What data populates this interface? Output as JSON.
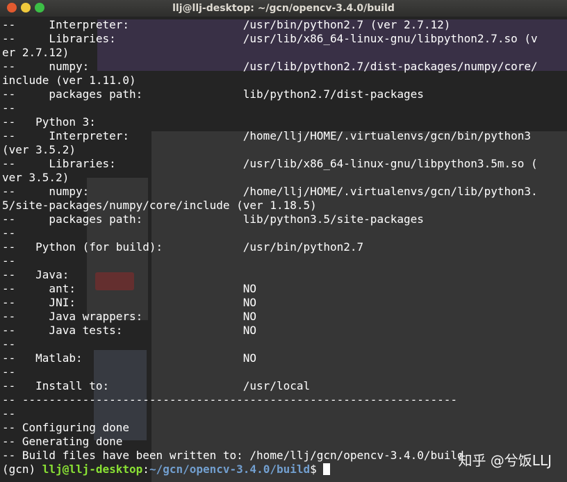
{
  "window": {
    "title": "llj@llj-desktop: ~/gcn/opencv-3.4.0/build"
  },
  "terminal": {
    "lines": [
      "--     Interpreter:                 /usr/bin/python2.7 (ver 2.7.12)",
      "--     Libraries:                   /usr/lib/x86_64-linux-gnu/libpython2.7.so (v",
      "er 2.7.12)",
      "--     numpy:                       /usr/lib/python2.7/dist-packages/numpy/core/",
      "include (ver 1.11.0)",
      "--     packages path:               lib/python2.7/dist-packages",
      "--",
      "--   Python 3:",
      "--     Interpreter:                 /home/llj/HOME/.virtualenvs/gcn/bin/python3",
      "(ver 3.5.2)",
      "--     Libraries:                   /usr/lib/x86_64-linux-gnu/libpython3.5m.so (",
      "ver 3.5.2)",
      "--     numpy:                       /home/llj/HOME/.virtualenvs/gcn/lib/python3.",
      "5/site-packages/numpy/core/include (ver 1.18.5)",
      "--     packages path:               lib/python3.5/site-packages",
      "--",
      "--   Python (for build):            /usr/bin/python2.7",
      "--",
      "--   Java:",
      "--     ant:                         NO",
      "--     JNI:                         NO",
      "--     Java wrappers:               NO",
      "--     Java tests:                  NO",
      "--",
      "--   Matlab:                        NO",
      "--",
      "--   Install to:                    /usr/local",
      "-- -----------------------------------------------------------------",
      "--",
      "-- Configuring done",
      "-- Generating done",
      "-- Build files have been written to: /home/llj/gcn/opencv-3.4.0/build"
    ],
    "prompt": {
      "env": "(gcn) ",
      "user_host": "llj@llj-desktop",
      "sep": ":",
      "path": "~/gcn/opencv-3.4.0/build",
      "symbol": "$ "
    }
  },
  "watermark": {
    "text": "知乎 @兮饭LLJ"
  }
}
